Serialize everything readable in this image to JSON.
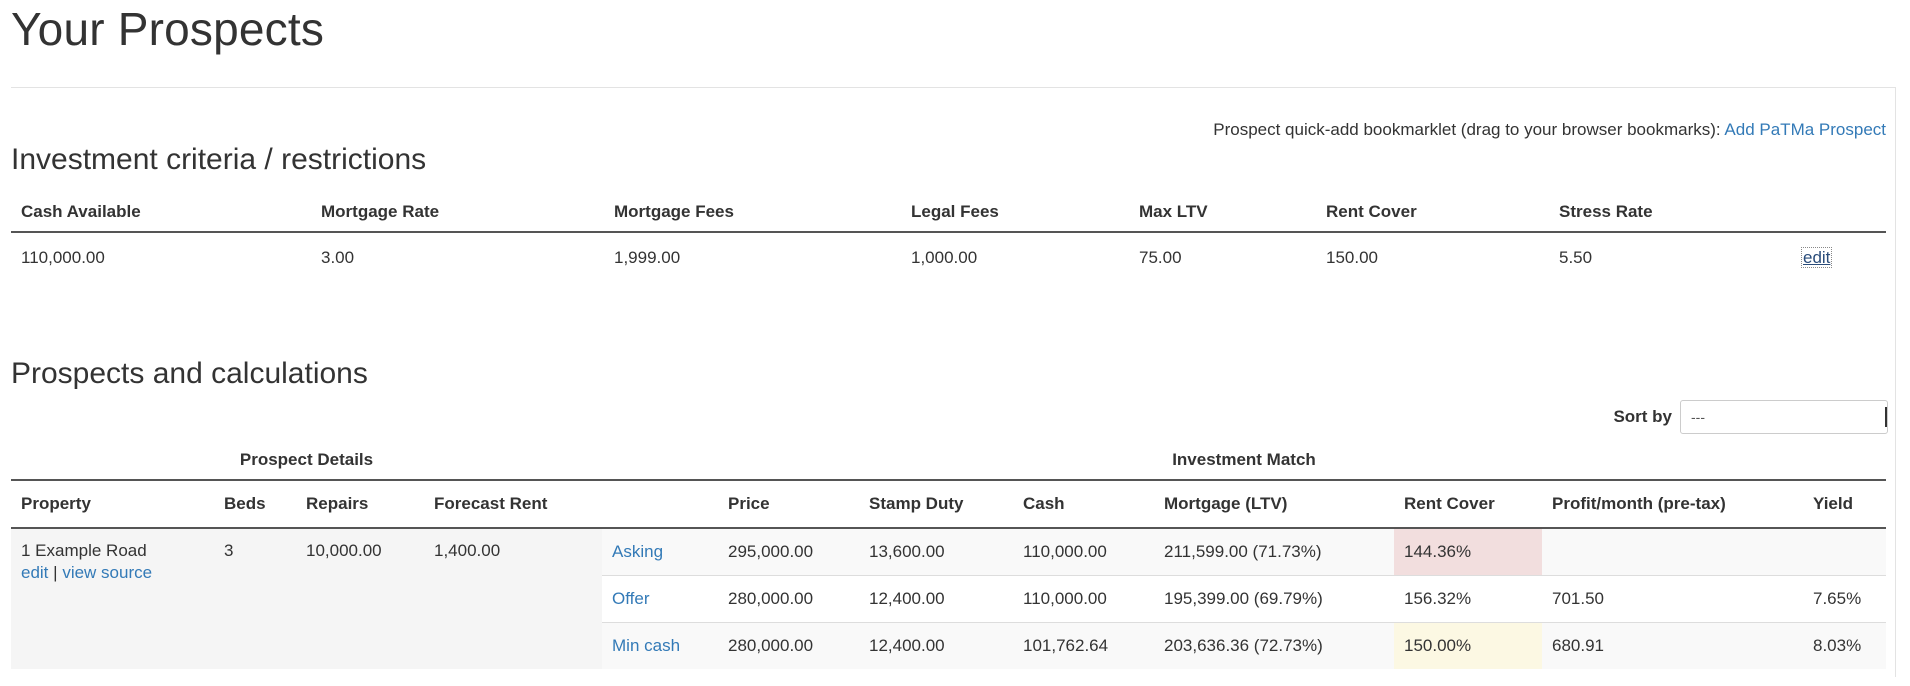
{
  "page": {
    "title": "Your Prospects"
  },
  "bookmarklet": {
    "text": "Prospect quick-add bookmarklet (drag to your browser bookmarks):",
    "link": "Add PaTMa Prospect"
  },
  "criteria": {
    "heading": "Investment criteria / restrictions",
    "headers": [
      "Cash Available",
      "Mortgage Rate",
      "Mortgage Fees",
      "Legal Fees",
      "Max LTV",
      "Rent Cover",
      "Stress Rate"
    ],
    "values": [
      "110,000.00",
      "3.00",
      "1,999.00",
      "1,000.00",
      "75.00",
      "150.00",
      "5.50"
    ],
    "edit_label": "edit"
  },
  "prospects": {
    "heading": "Prospects and calculations",
    "sort": {
      "label": "Sort by",
      "value": "---"
    },
    "groups": {
      "details": "Prospect Details",
      "match": "Investment Match"
    },
    "headers": [
      "Property",
      "Beds",
      "Repairs",
      "Forecast Rent",
      "",
      "Price",
      "Stamp Duty",
      "Cash",
      "Mortgage (LTV)",
      "Rent Cover",
      "Profit/month (pre-tax)",
      "Yield"
    ],
    "rows": [
      {
        "property": "1 Example Road",
        "edit_label": "edit",
        "separator": "|",
        "view_source_label": "view source",
        "beds": "3",
        "repairs": "10,000.00",
        "forecast_rent": "1,400.00",
        "scenarios": [
          {
            "label": "Asking",
            "price": "295,000.00",
            "stamp_duty": "13,600.00",
            "cash": "110,000.00",
            "mortgage": "211,599.00 (71.73%)",
            "rent_cover": "144.36%",
            "profit": "",
            "yield": ""
          },
          {
            "label": "Offer",
            "price": "280,000.00",
            "stamp_duty": "12,400.00",
            "cash": "110,000.00",
            "mortgage": "195,399.00 (69.79%)",
            "rent_cover": "156.32%",
            "profit": "701.50",
            "yield": "7.65%"
          },
          {
            "label": "Min cash",
            "price": "280,000.00",
            "stamp_duty": "12,400.00",
            "cash": "101,762.64",
            "mortgage": "203,636.36 (72.73%)",
            "rent_cover": "150.00%",
            "profit": "680.91",
            "yield": "8.03%"
          }
        ]
      }
    ]
  },
  "colors": {
    "link": "#337ab7",
    "danger_bg": "#f2dede",
    "warning_bg": "#fcf8e3",
    "details_bg": "#f5f5f5"
  }
}
